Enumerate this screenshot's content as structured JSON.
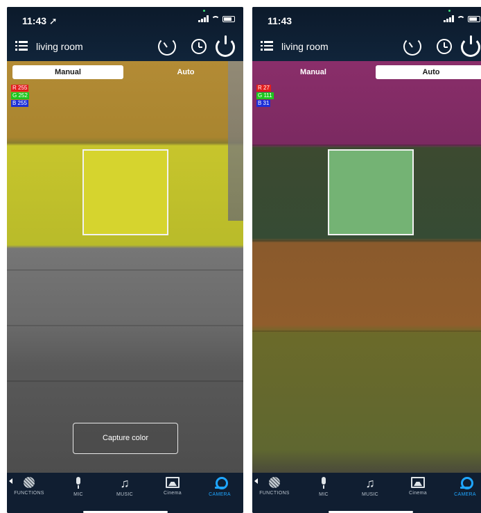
{
  "screens": [
    {
      "status_time": "11:43 ➚",
      "room_title": "living room",
      "tabs": {
        "manual": "Manual",
        "auto": "Auto",
        "active": "manual"
      },
      "rgb": {
        "r": "R 255",
        "g": "G 252",
        "b": "B 255"
      },
      "swatch_color": "#d6d42e",
      "capture_button": "Capture color"
    },
    {
      "status_time": "11:43",
      "room_title": "living room",
      "tabs": {
        "manual": "Manual",
        "auto": "Auto",
        "active": "auto"
      },
      "rgb": {
        "r": "R 27",
        "g": "G 111",
        "b": "B 31"
      },
      "swatch_color": "#74b374"
    }
  ],
  "nav": {
    "functions": "FUNCTIONS",
    "mic": "MIC",
    "music": "MUSIC",
    "cinema": "Cinema",
    "camera": "CAMERA",
    "active": "camera"
  },
  "colors": {
    "accent": "#1fa6ff",
    "header_bg": "#0c1a2b"
  }
}
